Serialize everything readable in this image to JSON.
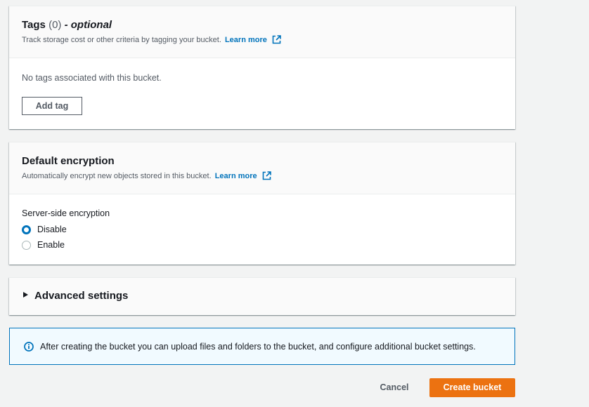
{
  "tags": {
    "title": "Tags",
    "count": "(0)",
    "optional": "- optional",
    "description": "Track storage cost or other criteria by tagging your bucket.",
    "learn_more": "Learn more",
    "empty_text": "No tags associated with this bucket.",
    "add_tag_label": "Add tag"
  },
  "encryption": {
    "title": "Default encryption",
    "description": "Automatically encrypt new objects stored in this bucket.",
    "learn_more": "Learn more",
    "field_label": "Server-side encryption",
    "options": [
      {
        "label": "Disable",
        "selected": true
      },
      {
        "label": "Enable",
        "selected": false
      }
    ]
  },
  "advanced": {
    "title": "Advanced settings",
    "expanded": false
  },
  "info": {
    "text": "After creating the bucket you can upload files and folders to the bucket, and configure additional bucket settings."
  },
  "actions": {
    "cancel_label": "Cancel",
    "create_label": "Create bucket"
  },
  "colors": {
    "primary": "#ec7211",
    "link": "#0073bb",
    "info_bg": "#f1faff"
  },
  "icons": {
    "external": "external-link-icon",
    "info": "info-icon",
    "caret": "caret-right-icon"
  }
}
